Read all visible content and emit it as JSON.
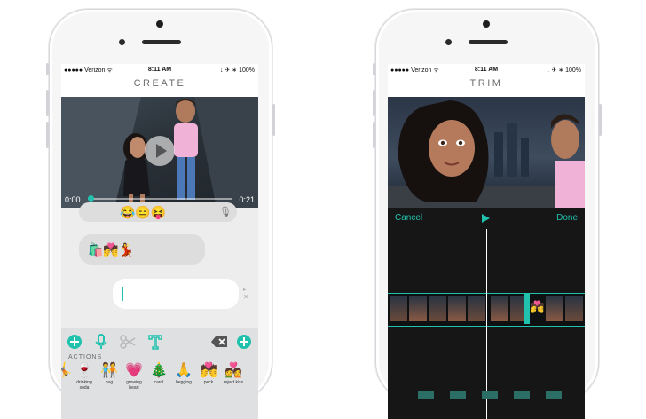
{
  "left_phone": {
    "status": {
      "carrier": "●●●●● Verizon ᯤ",
      "time": "8:11 AM",
      "battery": "↓ ✈ ∗ 100%"
    },
    "title": "CREATE",
    "video": {
      "current_time": "0:00",
      "duration": "0:21"
    },
    "chat": {
      "top_bubble": "😂😑😝",
      "emoji_bubble": "🛍️💏💃"
    },
    "toolbar": {
      "actions_label": "ACTIONS",
      "stickers": [
        {
          "glyph": "🤸",
          "label": ""
        },
        {
          "glyph": "🍷",
          "label": "drinking soda"
        },
        {
          "glyph": "🧑‍🤝‍🧑",
          "label": "hug"
        },
        {
          "glyph": "💗",
          "label": "growing heart"
        },
        {
          "glyph": "🎄",
          "label": "carol"
        },
        {
          "glyph": "🙏",
          "label": "begging"
        },
        {
          "glyph": "💏",
          "label": "peck"
        },
        {
          "glyph": "💑",
          "label": "reject kiss"
        }
      ]
    }
  },
  "right_phone": {
    "status": {
      "carrier": "●●●●● Verizon ᯤ",
      "time": "8:11 AM",
      "battery": "↓ ✈ ∗ 100%"
    },
    "title": "TRIM",
    "cancel_label": "Cancel",
    "done_label": "Done",
    "strip_sticker": "💏"
  },
  "colors": {
    "accent": "#21c2ad",
    "dark_panel": "#161616",
    "chat_bg": "#ededed",
    "toolbar_bg": "#dfe0e2"
  },
  "icons": [
    "play-icon",
    "add-icon",
    "mic-icon",
    "scissors-icon",
    "text-icon",
    "backspace-icon",
    "search-add-icon",
    "mic-bubble-icon",
    "close-icon"
  ]
}
